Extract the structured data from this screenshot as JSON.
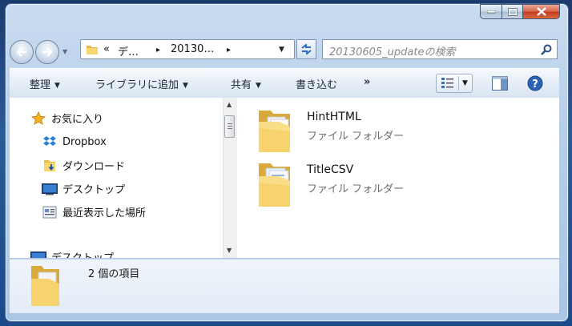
{
  "caption_buttons": {
    "minimize": "minimize",
    "maximize": "maximize",
    "close": "close"
  },
  "nav": {
    "crumb_prefix": "«",
    "crumbs": [
      "デ…",
      "20130…"
    ],
    "separator": "▸"
  },
  "search": {
    "placeholder": "20130605_updateの検索"
  },
  "toolbar": {
    "organize": "整理",
    "add_to_library": "ライブラリに追加",
    "share": "共有",
    "burn": "書き込む",
    "more": "»"
  },
  "nav_pane": {
    "favorites": "お気に入り",
    "items": [
      "Dropbox",
      "ダウンロード",
      "デスクトップ",
      "最近表示した場所"
    ],
    "desktop": "デスクトップ"
  },
  "files": [
    {
      "name": "HintHTML",
      "type": "ファイル フォルダー",
      "icon": "folder-icon"
    },
    {
      "name": "TitleCSV",
      "type": "ファイル フォルダー",
      "icon": "folder-icon"
    }
  ],
  "status": {
    "count": "2 個の項目"
  },
  "colors": {
    "accent": "#2a5a9a",
    "folder": "#f3cf62",
    "close": "#c2391c"
  }
}
